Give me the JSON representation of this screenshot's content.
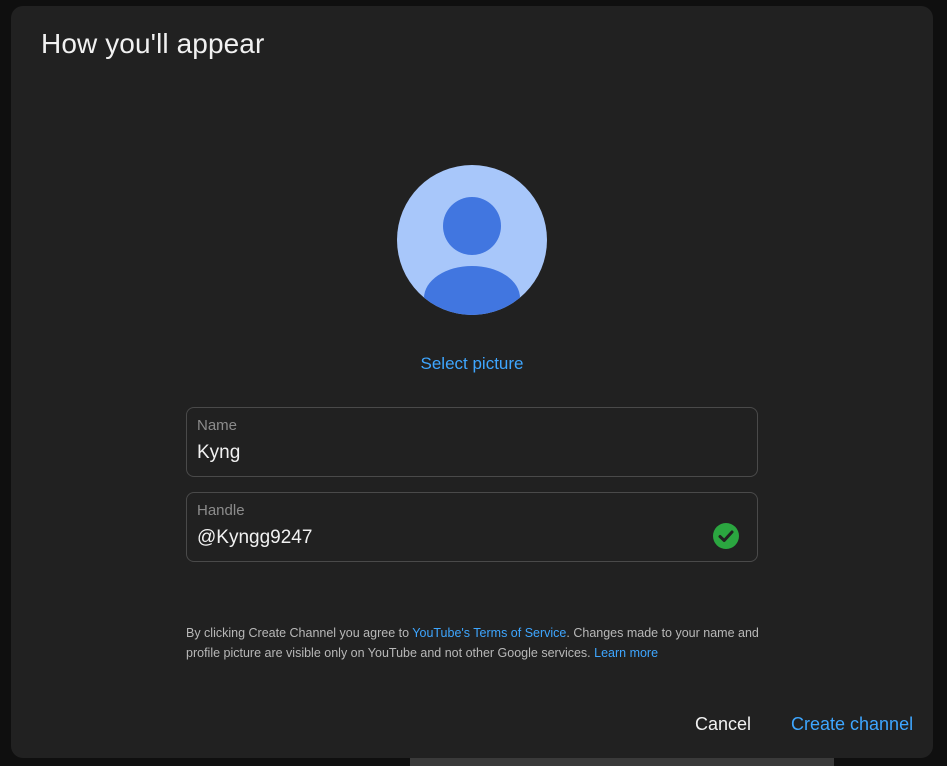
{
  "dialog": {
    "title": "How you'll appear"
  },
  "avatar": {
    "icon": "default-person-avatar",
    "background_color": "#a8c7fa",
    "figure_color": "#4176e0"
  },
  "select_picture_label": "Select picture",
  "name_field": {
    "label": "Name",
    "value": "Kyng"
  },
  "handle_field": {
    "label": "Handle",
    "value": "@Kyngg9247",
    "status_icon": "check-circle-icon",
    "status_color": "#2ba640"
  },
  "terms": {
    "text_before": "By clicking Create Channel you agree to ",
    "tos_link": "YouTube's Terms of Service",
    "text_middle": ". Changes made to your name and profile picture are visible only on YouTube and not other Google services. ",
    "learn_more_link": "Learn more"
  },
  "actions": {
    "cancel_label": "Cancel",
    "create_label": "Create channel"
  },
  "colors": {
    "dialog_bg": "#212121",
    "accent": "#3ea6ff"
  }
}
